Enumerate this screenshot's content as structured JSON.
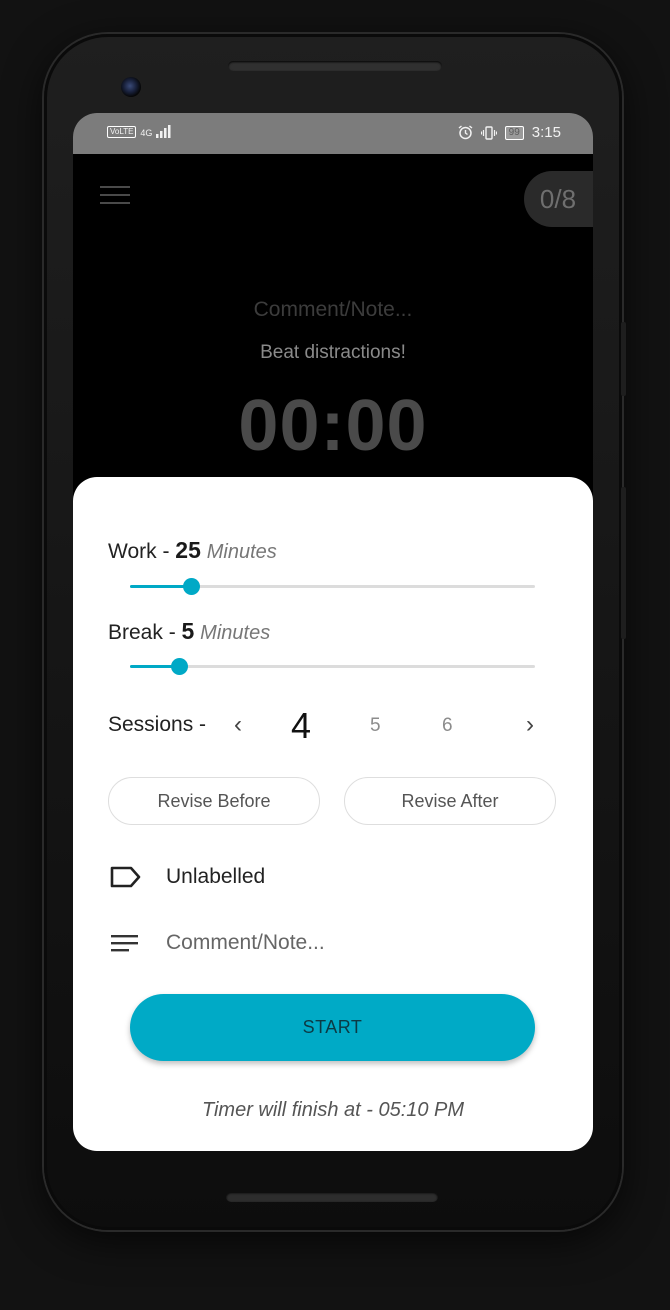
{
  "status_bar": {
    "network_badge": "VoLTE",
    "network_type": "4G",
    "battery": "99",
    "time": "3:15"
  },
  "header": {
    "menu_icon": "hamburger-menu-icon",
    "session_counter": "0/8"
  },
  "timer_view": {
    "comment_placeholder": "Comment/Note...",
    "motto": "Beat distractions!",
    "time": "00:00"
  },
  "settings": {
    "work": {
      "label": "Work - ",
      "value": "25",
      "unit": "Minutes",
      "slider_fraction": 0.15
    },
    "break": {
      "label": "Break - ",
      "value": "5",
      "unit": "Minutes",
      "slider_fraction": 0.12
    },
    "sessions": {
      "label": "Sessions -",
      "selected": "4",
      "options": [
        "5",
        "6"
      ]
    },
    "revise_before": "Revise Before",
    "revise_after": "Revise After",
    "label_field": {
      "icon": "label-tag-icon",
      "value": "Unlabelled"
    },
    "comment_field": {
      "icon": "notes-lines-icon",
      "placeholder": "Comment/Note..."
    },
    "start_button": "START",
    "finish_text": "Timer will finish at - 05:10 PM"
  },
  "colors": {
    "accent": "#00a9c6",
    "status_bar": "#7c7c7c",
    "background": "#000000",
    "sheet": "#ffffff"
  }
}
